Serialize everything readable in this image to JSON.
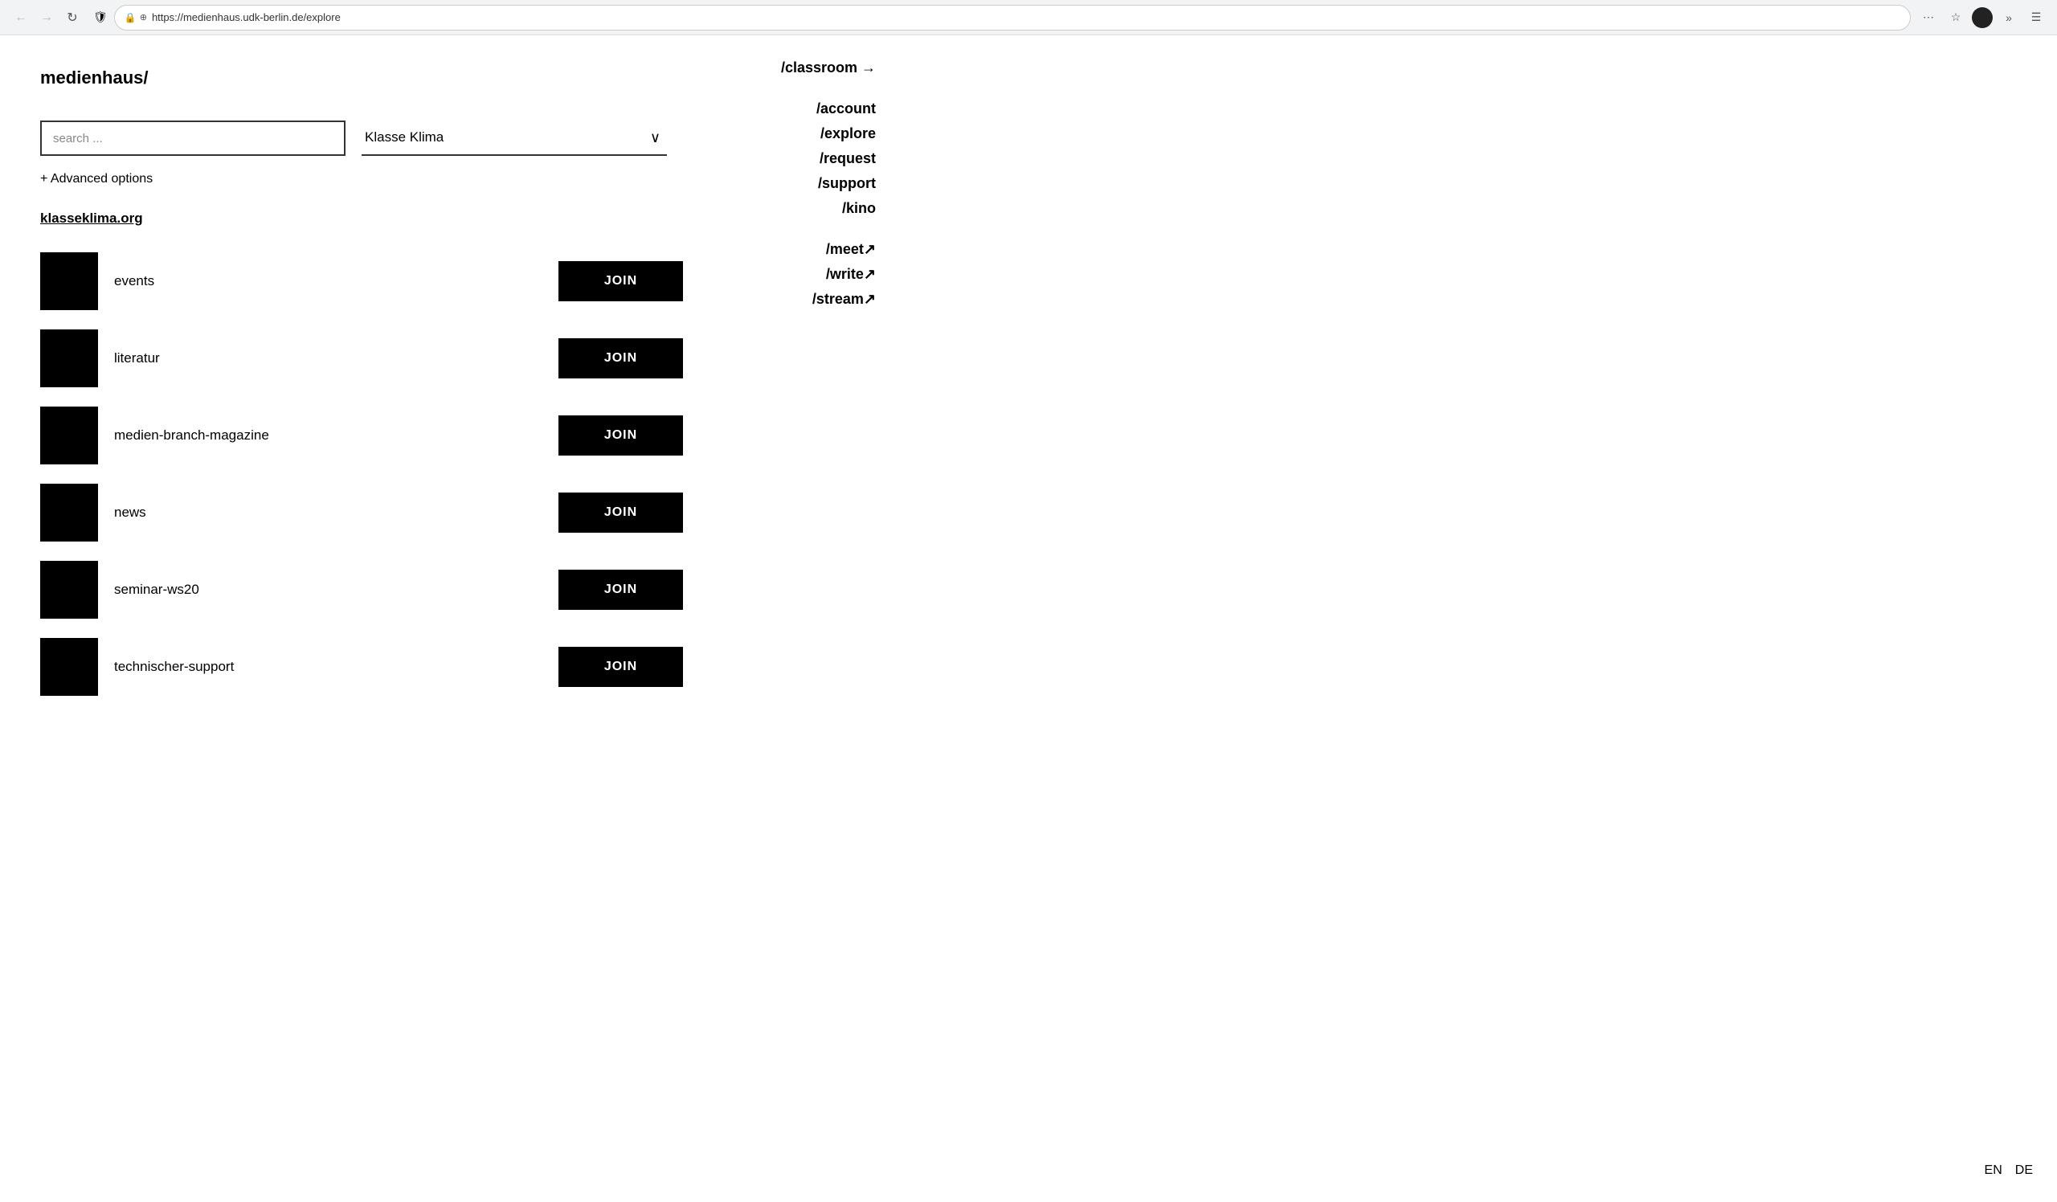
{
  "browser": {
    "url": "https://medienhaus.udk-berlin.de/explore",
    "nav": {
      "back_label": "←",
      "forward_label": "→",
      "reload_label": "↻"
    },
    "menu_label": "⋯",
    "star_label": "☆",
    "extend_label": "»",
    "hamburger_label": "☰"
  },
  "header": {
    "site_title": "medienhaus/"
  },
  "search": {
    "placeholder": "search ...",
    "dropdown_label": "Klasse Klima",
    "dropdown_arrow": "∨",
    "advanced_options": "+ Advanced options"
  },
  "group": {
    "heading": "klasseklima.org"
  },
  "channels": [
    {
      "name": "events",
      "join_label": "JOIN"
    },
    {
      "name": "literatur",
      "join_label": "JOIN"
    },
    {
      "name": "medien-branch-magazine",
      "join_label": "JOIN"
    },
    {
      "name": "news",
      "join_label": "JOIN"
    },
    {
      "name": "seminar-ws20",
      "join_label": "JOIN"
    },
    {
      "name": "technischer-support",
      "join_label": "JOIN"
    }
  ],
  "right_nav": {
    "classroom": "/classroom →",
    "account": "/account",
    "explore": "/explore",
    "request": "/request",
    "support": "/support",
    "kino": "/kino",
    "meet": "/meet↗",
    "write": "/write↗",
    "stream": "/stream↗"
  },
  "lang": {
    "en": "EN",
    "de": "DE"
  }
}
